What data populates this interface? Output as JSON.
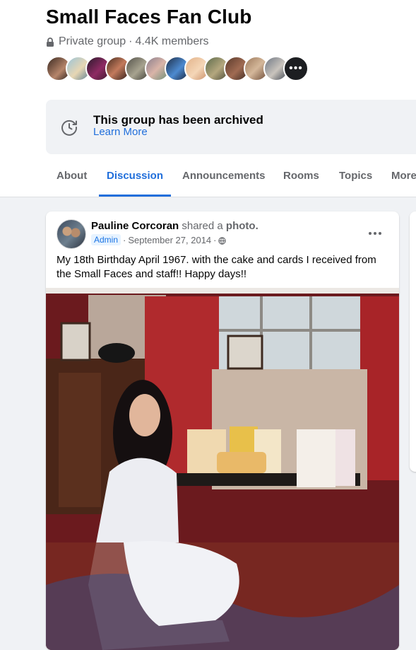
{
  "group": {
    "name": "Small Faces Fan Club",
    "privacy": "Private group",
    "separator": "·",
    "members": "4.4K members",
    "more_members_glyph": "•••"
  },
  "archive": {
    "title": "This group has been archived",
    "link": "Learn More"
  },
  "tabs": [
    "About",
    "Discussion",
    "Announcements",
    "Rooms",
    "Topics",
    "More"
  ],
  "active_tab": "Discussion",
  "post": {
    "author": "Pauline Corcoran",
    "action": "shared a",
    "object": "photo.",
    "badge": "Admin",
    "separator": "·",
    "date": "September 27, 2014",
    "audience_icon": "globe-icon",
    "text": "My 18th Birthday April 1967.   with the cake and cards I received from the Small Faces and staff!!    Happy days!!"
  },
  "icons": {
    "lock": "lock-icon",
    "archive": "archive-clock-icon",
    "menu": "more-options-icon"
  },
  "colors": {
    "accent": "#216fdb",
    "secondary_text": "#65676b",
    "page_bg": "#f0f2f5"
  }
}
